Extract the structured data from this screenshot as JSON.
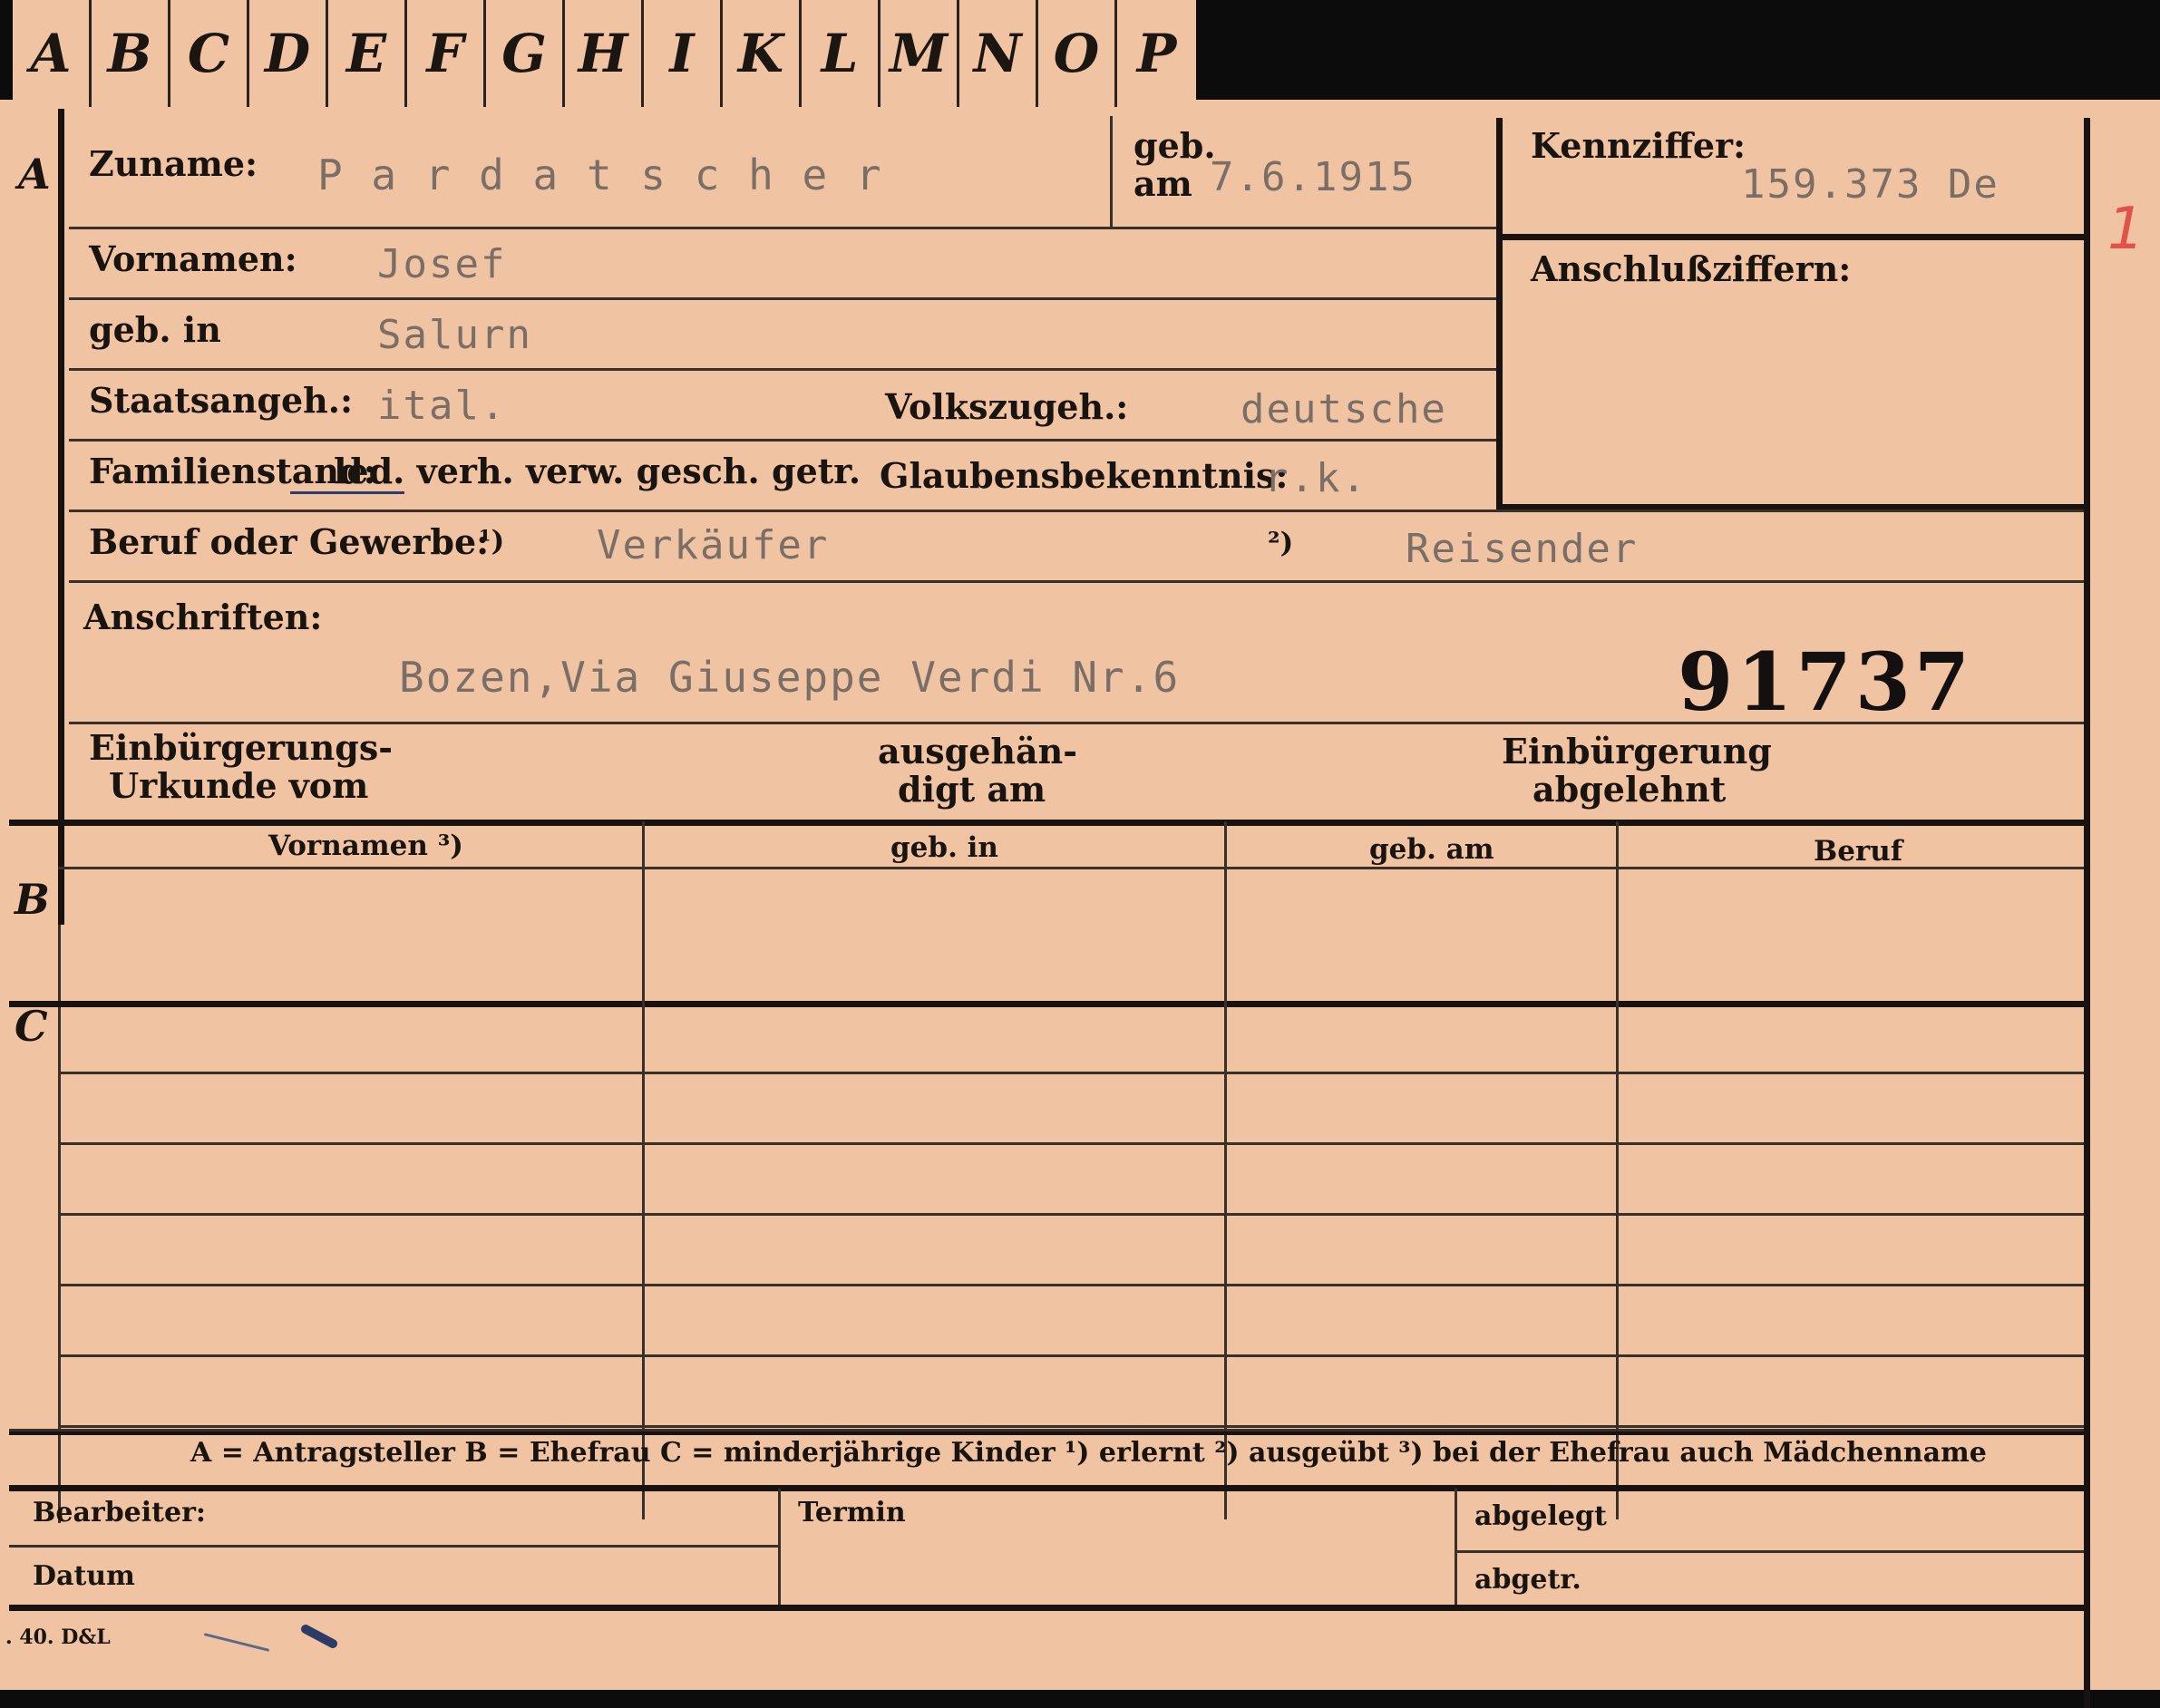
{
  "tabs": [
    "A",
    "B",
    "C",
    "D",
    "E",
    "F",
    "G",
    "H",
    "I",
    "K",
    "L",
    "M",
    "N",
    "O",
    "P"
  ],
  "row_letters": {
    "a": "A",
    "b": "B",
    "c": "C"
  },
  "labels": {
    "zuname": "Zuname:",
    "geb_am_1": "geb.",
    "geb_am_2": "am",
    "kennziffer": "Kennziffer:",
    "anschlussziffern": "Anschlußziffern:",
    "vornamen": "Vornamen:",
    "geb_in": "geb. in",
    "staatsangeh": "Staatsangeh.:",
    "volkszugeh": "Volkszugeh.:",
    "familienstand_prefix": "Familienstand:",
    "familienstand_options": "led. verh. verw. gesch. getr.",
    "glaubensbekenntnis": "Glaubensbekenntnis:",
    "beruf": "Beruf oder Gewerbe:",
    "beruf_note1": "¹)",
    "beruf_note2": "²)",
    "anschriften": "Anschriften:",
    "einbuergerung_urkunde_1": "Einbürgerungs-",
    "einbuergerung_urkunde_2": "Urkunde vom",
    "ausgehaendigt_1": "ausgehän-",
    "ausgehaendigt_2": "digt am",
    "einbuergerung_abgelehnt_1": "Einbürgerung",
    "einbuergerung_abgelehnt_2": "abgelehnt"
  },
  "values": {
    "zuname": "P a r d a t s c h e r",
    "geb_am": "7.6.1915",
    "kennziffer": "159.373  De",
    "vornamen": "Josef",
    "geb_in": "Salurn",
    "staatsangeh": "ital.",
    "volkszugeh": "deutsche",
    "glaubensbekenntnis": "r.k.",
    "beruf_erlernt": "Verkäufer",
    "beruf_ausgeuebt": "Reisender",
    "anschrift": "Bozen,Via Giuseppe Verdi Nr.6",
    "number": "91737",
    "red_mark": "1"
  },
  "table": {
    "headers": [
      "Vornamen ³)",
      "geb. in",
      "geb. am",
      "Beruf"
    ]
  },
  "legend": "A = Antragsteller   B = Ehefrau   C = minderjährige Kinder   ¹) erlernt   ²) ausgeübt   ³) bei der Ehefrau auch Mädchenname",
  "footer": {
    "bearbeiter": "Bearbeiter:",
    "datum": "Datum",
    "termin": "Termin",
    "abgelegt": "abgelegt",
    "abgetr": "abgetr."
  },
  "printer_mark": ". 40.  D&L"
}
